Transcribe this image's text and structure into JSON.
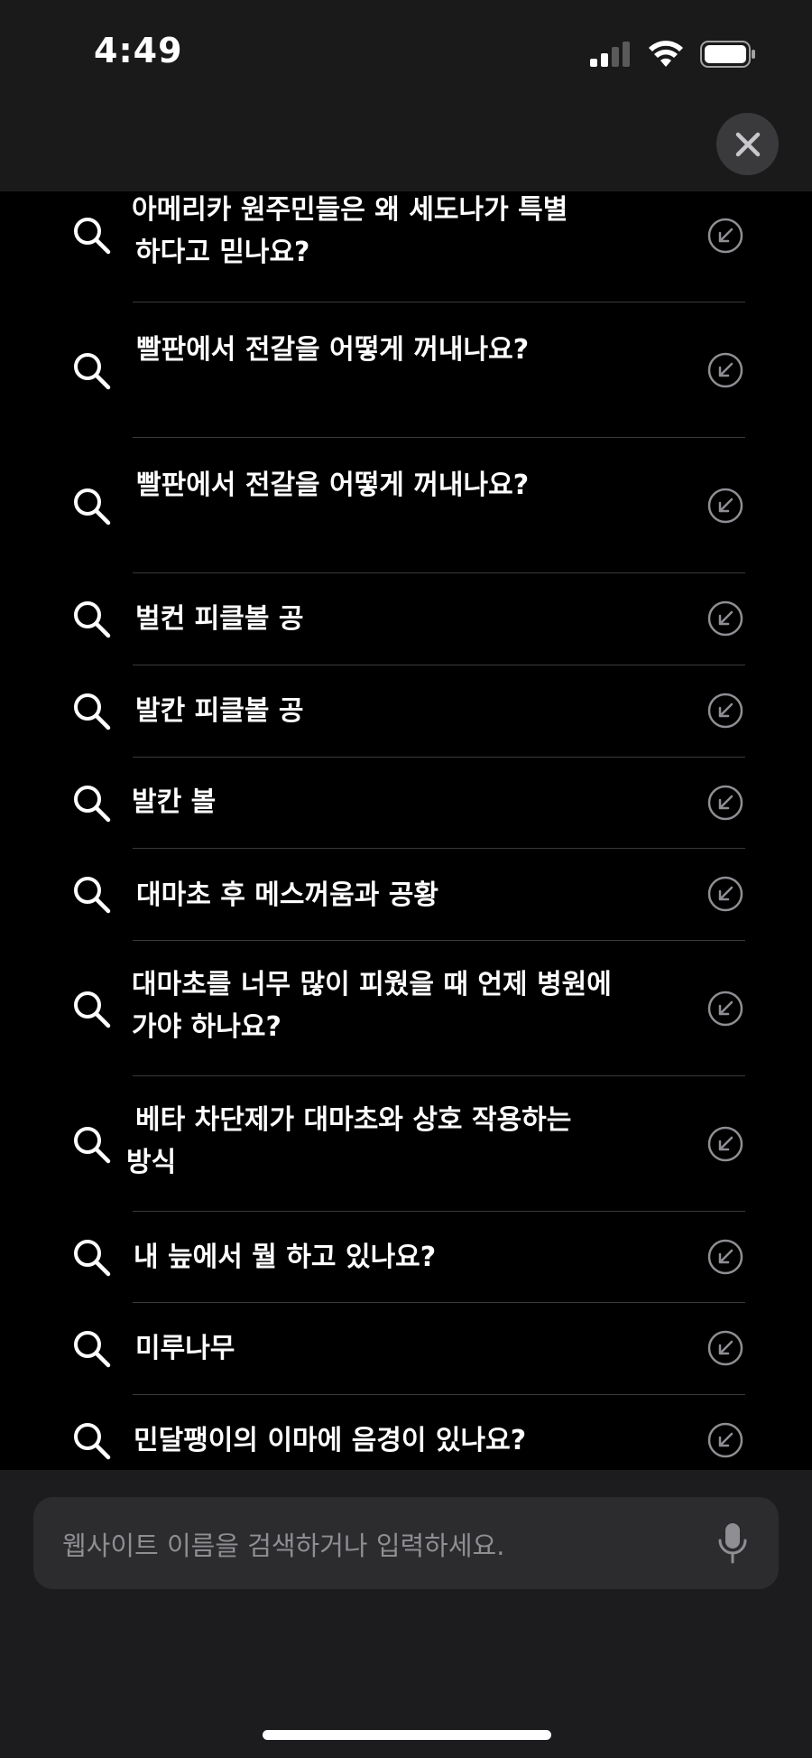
{
  "status_bar": {
    "time": "4:49",
    "icons": [
      "signal-icon",
      "wifi-icon",
      "battery-icon"
    ]
  },
  "header": {
    "close_icon": "close-icon"
  },
  "suggestions": [
    {
      "line1": "아메리카 원주민들은 왜 세도나가 특별",
      "line2": "하다고 믿나요?"
    },
    {
      "line1": "빨판에서 전갈을 어떻게 꺼내나요?",
      "line2": ""
    },
    {
      "line1": "빨판에서 전갈을 어떻게 꺼내나요?",
      "line2": ""
    },
    {
      "line1": "벌컨 피클볼 공",
      "line2": ""
    },
    {
      "line1": "발칸 피클볼 공",
      "line2": ""
    },
    {
      "line1": "발칸 볼",
      "line2": ""
    },
    {
      "line1": "대마초 후 메스꺼움과 공황",
      "line2": ""
    },
    {
      "line1": "대마초를 너무 많이 피웠을 때 언제 병원에",
      "line2": "가야 하나요?"
    },
    {
      "line1": "베타 차단제가 대마초와 상호 작용하는",
      "line2": "방식"
    },
    {
      "line1": "내 늪에서 뭘 하고 있나요?",
      "line2": ""
    },
    {
      "line1": "미루나무",
      "line2": ""
    },
    {
      "line1": "민달팽이의 이마에 음경이 있나요?",
      "line2": ""
    }
  ],
  "search": {
    "placeholder": "웹사이트 이름을 검색하거나 입력하세요.",
    "mic_icon": "microphone-icon"
  },
  "colors": {
    "background": "#000000",
    "header": "#1a1a1a",
    "bottom_bar": "#1c1c1e",
    "search_field": "#2c2c2e",
    "placeholder_text": "#8e8e93"
  }
}
